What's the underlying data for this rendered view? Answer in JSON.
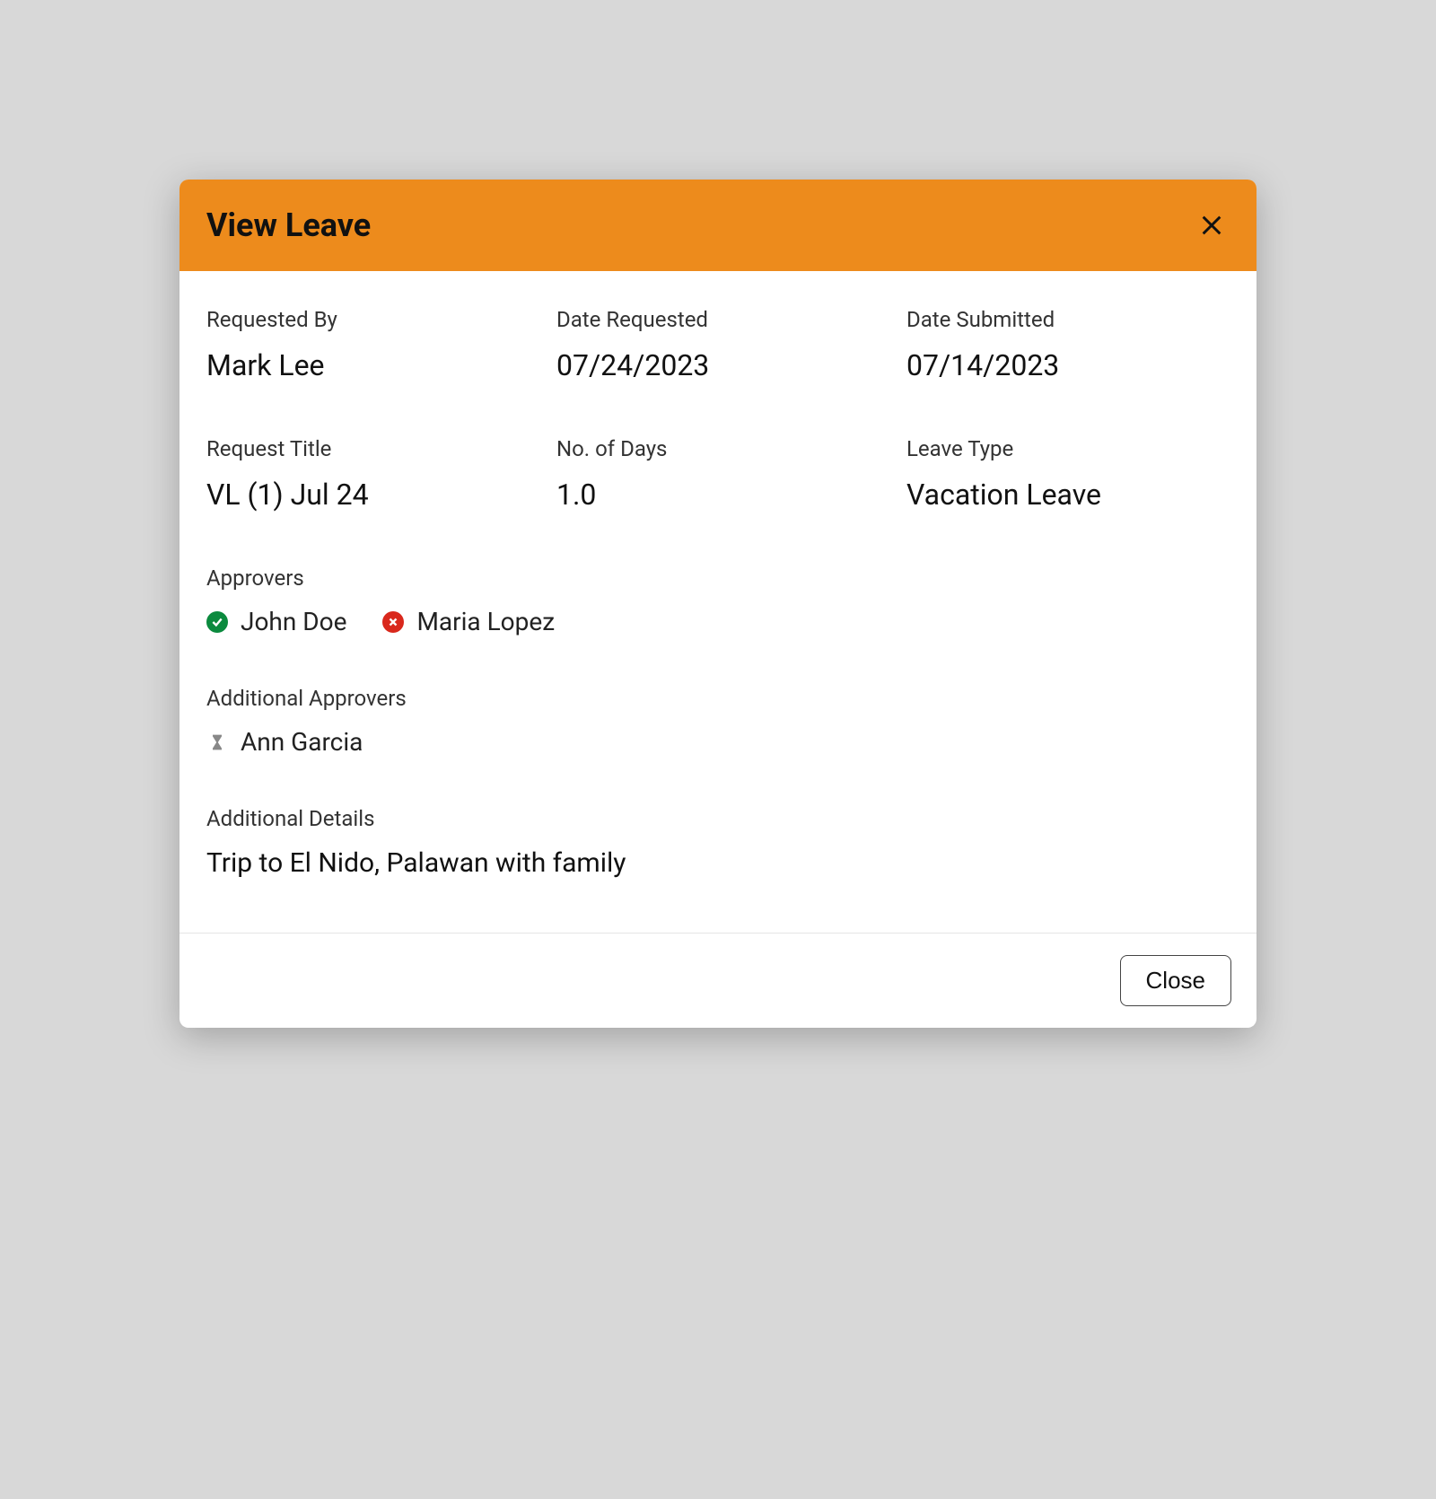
{
  "modal": {
    "title": "View Leave",
    "fields": {
      "requested_by": {
        "label": "Requested By",
        "value": "Mark Lee"
      },
      "date_requested": {
        "label": "Date Requested",
        "value": "07/24/2023"
      },
      "date_submitted": {
        "label": "Date Submitted",
        "value": "07/14/2023"
      },
      "request_title": {
        "label": "Request Title",
        "value": "VL (1) Jul 24"
      },
      "no_of_days": {
        "label": "No. of Days",
        "value": "1.0"
      },
      "leave_type": {
        "label": "Leave Type",
        "value": "Vacation Leave"
      }
    },
    "approvers": {
      "label": "Approvers",
      "items": [
        {
          "name": "John Doe",
          "status": "approved"
        },
        {
          "name": "Maria Lopez",
          "status": "rejected"
        }
      ]
    },
    "additional_approvers": {
      "label": "Additional Approvers",
      "items": [
        {
          "name": "Ann Garcia",
          "status": "pending"
        }
      ]
    },
    "additional_details": {
      "label": "Additional Details",
      "value": "Trip to El Nido, Palawan with family"
    },
    "footer": {
      "close_label": "Close"
    }
  }
}
